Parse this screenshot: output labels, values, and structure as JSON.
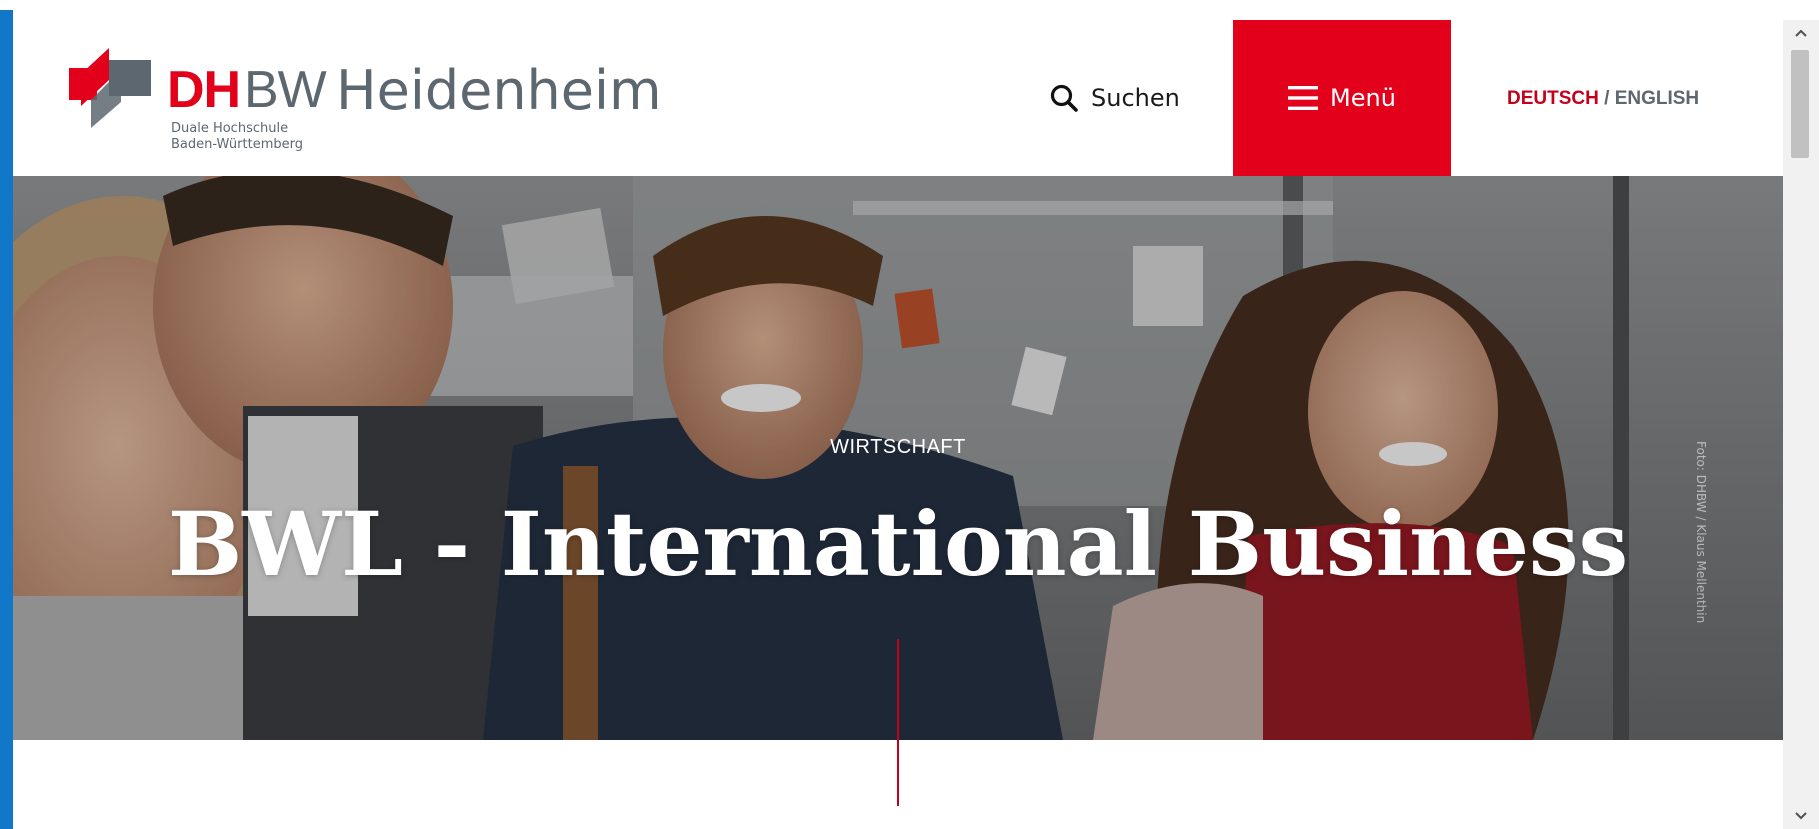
{
  "header": {
    "logo": {
      "brand_red": "DH",
      "brand_gray": "BW",
      "subtitle_line1": "Duale Hochschule",
      "subtitle_line2": "Baden-Württemberg"
    },
    "site_title": "Heidenheim",
    "search_label": "Suchen",
    "menu_label": "Menü",
    "language": {
      "active": "DEUTSCH",
      "separator": " / ",
      "other": "ENGLISH"
    }
  },
  "hero": {
    "kicker": "WIRTSCHAFT",
    "title": "BWL - International Business",
    "photo_credit": "Foto: DHBW / Klaus Mellenthin"
  },
  "colors": {
    "brand_red": "#e2001a",
    "brand_gray": "#5d6770",
    "accent_line": "#c4001a",
    "window_edge": "#1177c8"
  },
  "icons": {
    "search": "search-icon",
    "menu": "hamburger-menu-icon",
    "scroll_up": "chevron-up-icon",
    "scroll_down": "chevron-down-icon"
  }
}
